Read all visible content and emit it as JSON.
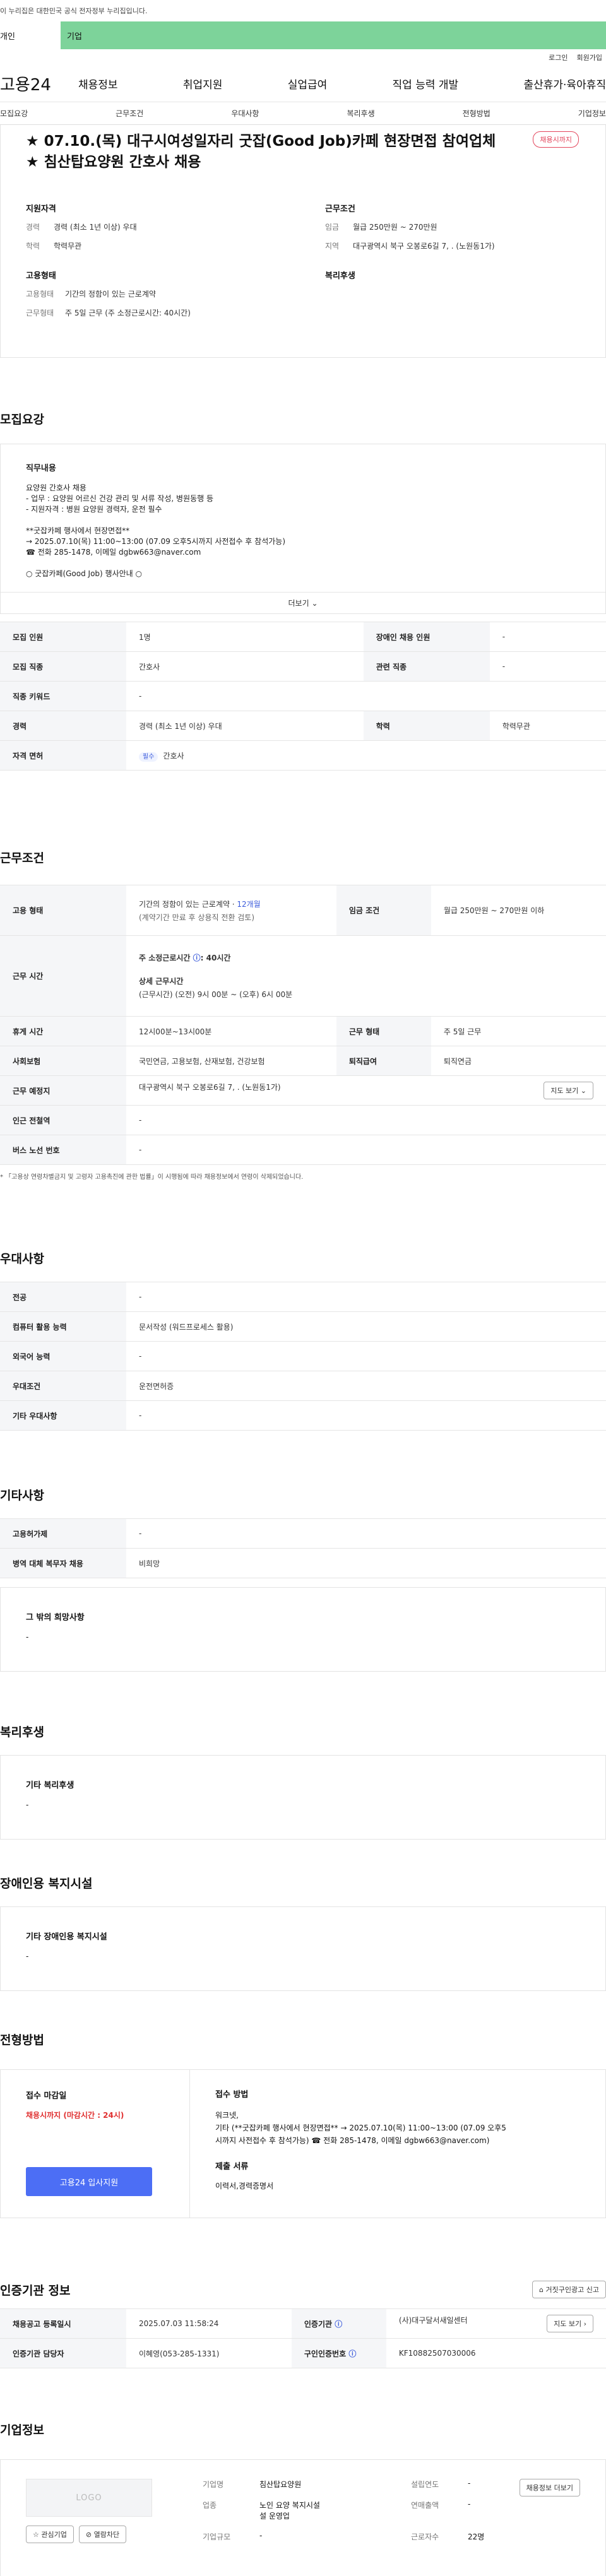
{
  "gov_banner": "이 누리집은 대한민국 공식 전자정부 누리집입니다.",
  "top_tabs": [
    "개인",
    "기업"
  ],
  "util": [
    "로그인",
    "회원가입"
  ],
  "brand": "고용24",
  "gnb": [
    "채용정보",
    "취업지원",
    "실업급여",
    "직업 능력 개발",
    "출산휴가·육아휴직"
  ],
  "subnav": [
    "모집요강",
    "근무조건",
    "우대사항",
    "복리후생",
    "전형방법",
    "기업정보"
  ],
  "job": {
    "title_line1": "★ 07.10.(목) 대구시여성일자리 굿잡(Good Job)카페 현장면접 참여업체",
    "title_line2": "★ 침산탑요양원 간호사 채용",
    "badge": "채용시까지",
    "qual_title": "지원자격",
    "qual": [
      {
        "k": "경력",
        "v": "경력 (최소 1년 이상) 우대"
      },
      {
        "k": "학력",
        "v": "학력무관"
      }
    ],
    "type_title": "고용형태",
    "type": [
      {
        "k": "고용형태",
        "v": "기간의 정함이 있는 근로계약"
      },
      {
        "k": "근무형태",
        "v": "주 5일 근무 (주 소정근로시간: 40시간)"
      }
    ],
    "cond_title": "근무조건",
    "cond": [
      {
        "k": "임금",
        "v": "월급 250만원 ~ 270만원"
      },
      {
        "k": "지역",
        "v": "대구광역시 북구 오봉로6길 7, . (노원동1가)"
      }
    ],
    "welfare_title": "복리후생"
  },
  "recruit": {
    "section": "모집요강",
    "desc_title": "직무내용",
    "desc_lines": [
      "요양원 간호사 채용",
      "- 업무 : 요양원 어르신 건강 관리 및 서류 작성, 병원동행 등",
      "- 지원자격 : 병원 요양원 경력자, 운전 필수",
      "",
      "**굿잡카페 행사에서 현장면접**",
      "→ 2025.07.10(목) 11:00~13:00  (07.09 오후5시까지 사전접수 후 참석가능)",
      "☎ 전화 285-1478, 이메일 dgbw663@naver.com",
      "",
      "○ 굿잡카페(Good Job) 행사안내 ○"
    ],
    "more": "더보기",
    "rows": [
      {
        "k1": "모집 인원",
        "v1": "1명",
        "k2": "장애인 채용 인원",
        "v2": "-"
      },
      {
        "k1": "모집 직종",
        "v1": "간호사",
        "k2": "관련 직종",
        "v2": "-"
      },
      {
        "k1": "직종 키워드",
        "v1": "-"
      },
      {
        "k1": "경력",
        "v1": "경력 (최소 1년 이상) 우대",
        "k2": "학력",
        "v2": "학력무관"
      },
      {
        "k1": "자격 면허",
        "tag": "필수",
        "v1": "간호사"
      }
    ]
  },
  "work": {
    "section": "근무조건",
    "emp_type_k": "고용 형태",
    "emp_type_v1": "기간의 정함이 있는 근로계약 · ",
    "emp_type_v1b": "12개월",
    "emp_type_v2": "(계약기간 만료 후 상용직 전환 검토)",
    "wage_k": "임금 조건",
    "wage_v": "월급 250만원 ~ 270만원 이하",
    "hours_k": "근무 시간",
    "hours_a": "주 소정근로시간 ",
    "hours_a2": ": 40시간",
    "hours_b": "상세 근무시간",
    "hours_c": "(근무시간) (오전) 9시 00분 ~ (오후) 6시 00분",
    "rest_k": "휴게 시간",
    "rest_v": "12시00분~13시00분",
    "form_k": "근무 형태",
    "form_v": "주 5일 근무",
    "ins_k": "사회보험",
    "ins_v": "국민연금, 고용보험, 산재보험, 건강보험",
    "ret_k": "퇴직급여",
    "ret_v": "퇴직연금",
    "place_k": "근무 예정지",
    "place_v": "대구광역시 북구 오봉로6길 7, . (노원동1가)",
    "map_btn": "지도 보기",
    "subway_k": "인근 전철역",
    "subway_v": "-",
    "bus_k": "버스 노선 번호",
    "bus_v": "-",
    "note": "* 「고용상 연령차별금지 및 고령자 고용촉진에 관한 법률」이 시행됨에 따라 채용정보에서 연령이 삭제되었습니다."
  },
  "pref": {
    "section": "우대사항",
    "rows": [
      {
        "k": "전공",
        "v": "-"
      },
      {
        "k": "컴퓨터 활용 능력",
        "v": "문서작성 (워드프로세스 활용)"
      },
      {
        "k": "외국어 능력",
        "v": "-"
      },
      {
        "k": "우대조건",
        "v": "운전면허증"
      },
      {
        "k": "기타 우대사항",
        "v": "-"
      }
    ]
  },
  "etc": {
    "section": "기타사항",
    "rows": [
      {
        "k": "고용허가제",
        "v": "-"
      },
      {
        "k": "병역 대체 복무자 채용",
        "v": "비희망"
      }
    ],
    "box_title": "그 밖의 희망사항",
    "box_value": "-"
  },
  "welfare": {
    "section": "복리후생",
    "box_title": "기타 복리후생",
    "box_value": "-"
  },
  "disabled": {
    "section": "장애인용 복지시설",
    "box_title": "기타 장애인용 복지시설",
    "box_value": "-"
  },
  "process": {
    "section": "전형방법",
    "deadline_title": "접수 마감일",
    "deadline_value": "채용시까지 (마감시간 : 24시)",
    "apply_btn": "고용24 입사지원",
    "method_title": "접수 방법",
    "method_lines": [
      "워크넷,",
      "기타 (**굿잡카페 행사에서 현장면접**      → 2025.07.10(목) 11:00~13:00  (07.09 오후5",
      "시까지 사전접수 후 참석가능)      ☎ 전화 285-1478, 이메일 dgbw663@naver.com)"
    ],
    "docs_title": "제출 서류",
    "docs_value": "이력서,경력증명서"
  },
  "cert": {
    "section": "인증기관 정보",
    "report_btn": "거짓구인광고 신고",
    "r1k1": "채용공고 등록일시",
    "r1v1": "2025.07.03 11:58:24",
    "r1k2": "인증기관",
    "r1v2": "(사)대구달서새일센터",
    "map_btn": "지도 보기",
    "r2k1": "인증기관 담당자",
    "r2v1": "이혜영(053-285-1331)",
    "r2k2": "구인인증번호",
    "r2v2": "KF10882507030006"
  },
  "company": {
    "section": "기업정보",
    "logo": "LOGO",
    "fav_btn": "관심기업",
    "block_btn": "열람차단",
    "list_btn": "채용정보 더보기",
    "name_k": "기업명",
    "name_v": "침산탑요양원",
    "year_k": "설립연도",
    "year_v": "-",
    "ind_k": "업종",
    "ind_v1": "노인 요양 복지시설",
    "ind_v2": "설 운영업",
    "sales_k": "연매출액",
    "sales_v": "-",
    "emp_k": "근로자수",
    "emp_v": "22명",
    "scale_k": "기업규모",
    "scale_v": "-"
  },
  "colors": {
    "accent": "#4c6ef5",
    "tab_green": "#7dd39a",
    "badge_red": "#e3465c"
  }
}
